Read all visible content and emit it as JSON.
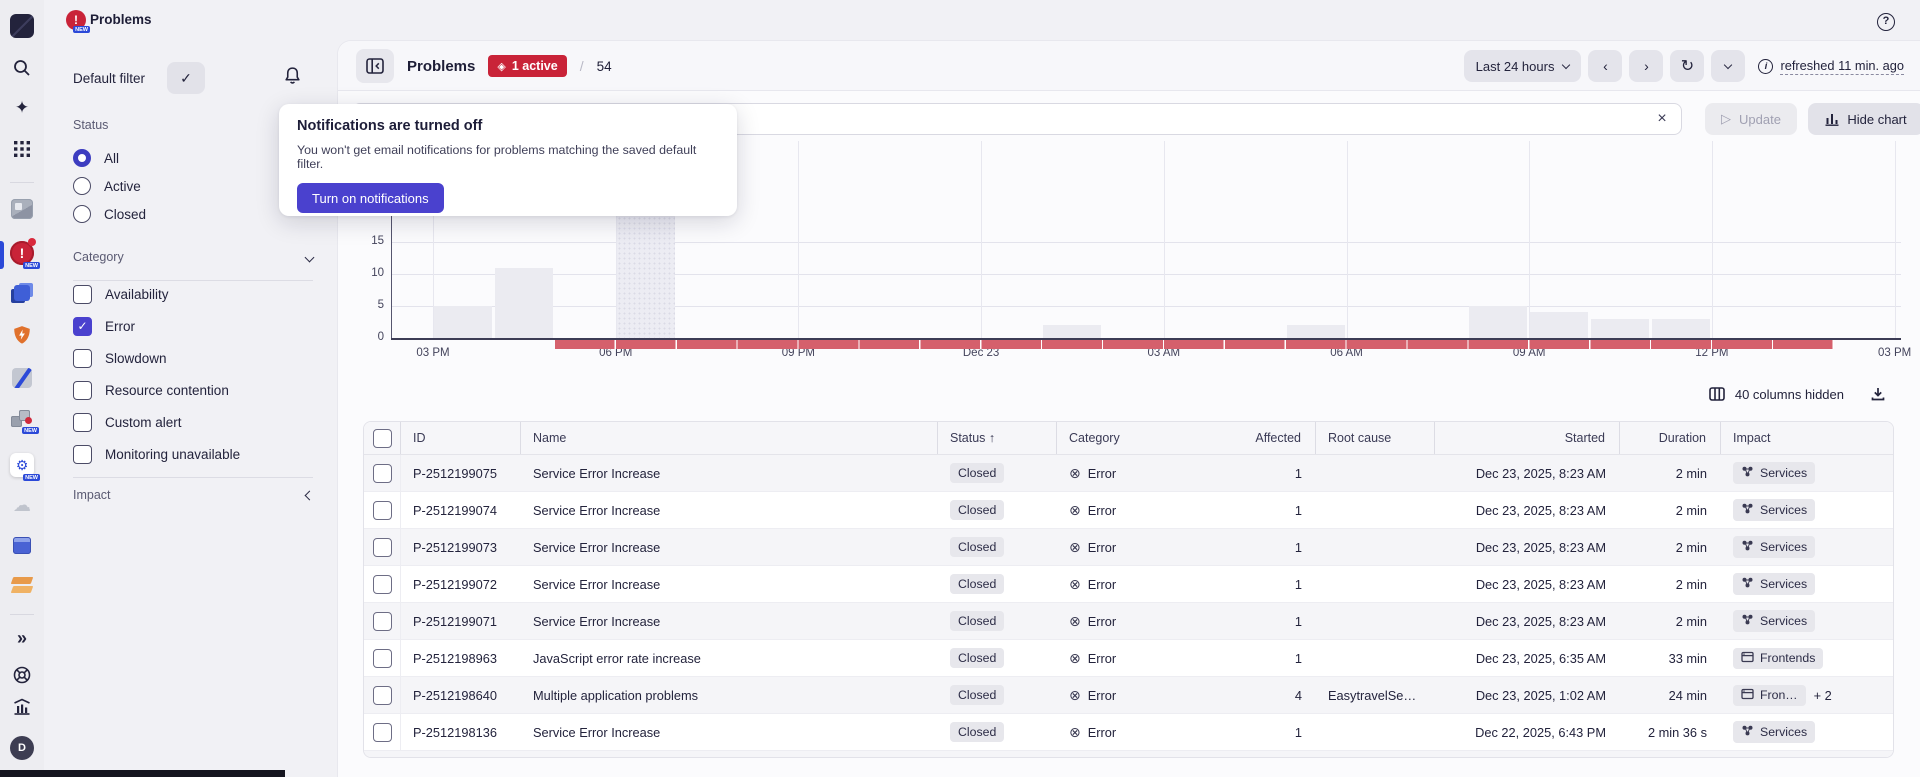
{
  "colors": {
    "accent": "#4a41ce",
    "badge_red": "#c92338",
    "problem_strip_red": "#d5606c",
    "active_indicator_blue": "#2b49d8"
  },
  "icons": {
    "check": "✓",
    "clear": "×",
    "prev": "‹",
    "next": "›",
    "refresh": "↻",
    "play": "▷",
    "circle_x": "⊗",
    "sort_up": "↑",
    "expand": "»",
    "cloud": "☁",
    "gear": "⚙",
    "sparkle": "✦",
    "diamond": "◈",
    "question": "?",
    "exclamation": "!",
    "info": "i",
    "slash": "/"
  },
  "topbar": {
    "app_title": "Problems"
  },
  "rail": {
    "avatar_letter": "D",
    "new_badge": "NEW"
  },
  "sidebar": {
    "default_filter_label": "Default filter",
    "status": {
      "label": "Status",
      "options": [
        {
          "label": "All",
          "selected": true
        },
        {
          "label": "Active",
          "selected": false
        },
        {
          "label": "Closed",
          "selected": false
        }
      ]
    },
    "category": {
      "label": "Category",
      "options": [
        {
          "label": "Availability",
          "checked": false
        },
        {
          "label": "Error",
          "checked": true
        },
        {
          "label": "Slowdown",
          "checked": false
        },
        {
          "label": "Resource contention",
          "checked": false
        },
        {
          "label": "Custom alert",
          "checked": false
        },
        {
          "label": "Monitoring unavailable",
          "checked": false
        }
      ]
    },
    "impact": {
      "label": "Impact"
    }
  },
  "popover": {
    "title": "Notifications are turned off",
    "body": "You won't get email notifications for problems matching the saved default filter.",
    "button": "Turn on notifications"
  },
  "header": {
    "title": "Problems",
    "active_badge": "1 active",
    "separator": "/",
    "total": "54",
    "time_range": "Last 24 hours",
    "refreshed": "refreshed 11 min. ago"
  },
  "filterbar": {
    "input_value": "",
    "update_label": "Update",
    "hide_chart_label": "Hide chart"
  },
  "chart_data": {
    "type": "bar",
    "title": "",
    "ylabel": "",
    "grid": true,
    "y_ticks": [
      0,
      5,
      10,
      15
    ],
    "x_tick_labels": [
      "03 PM",
      "06 PM",
      "09 PM",
      "Dec 23",
      "03 AM",
      "06 AM",
      "09 AM",
      "12 PM",
      "03 PM"
    ],
    "x_axis_start": "Dec 22, 2 PM",
    "bars": [
      {
        "time": "Dec 22, 3 PM",
        "hour_offset": 1,
        "value": 5
      },
      {
        "time": "Dec 22, 4 PM",
        "hour_offset": 2,
        "value": 11
      },
      {
        "time": "Dec 22, 6 PM",
        "hour_offset": 4,
        "value": 30,
        "highlight": true
      },
      {
        "time": "Dec 23, 1 AM",
        "hour_offset": 11,
        "value": 2
      },
      {
        "time": "Dec 23, 5 AM",
        "hour_offset": 15,
        "value": 2
      },
      {
        "time": "Dec 23, 8 AM",
        "hour_offset": 18,
        "value": 5
      },
      {
        "time": "Dec 23, 9 AM",
        "hour_offset": 19,
        "value": 4
      },
      {
        "time": "Dec 23, 10 AM",
        "hour_offset": 20,
        "value": 3
      },
      {
        "time": "Dec 23, 11 AM",
        "hour_offset": 21,
        "value": 3
      }
    ],
    "problem_timeline_strip": {
      "color": "#d5606c",
      "from_hour_offset": 3,
      "to_hour_offset": 24,
      "description": "red segmented strip along baseline marking problem activity from Dec 22 5 PM to Dec 23 2 PM"
    }
  },
  "table": {
    "columns_hidden": "40 columns hidden",
    "headers": [
      {
        "label": "ID"
      },
      {
        "label": "Name"
      },
      {
        "label": "Status",
        "sorted": "asc"
      },
      {
        "label": "Category"
      },
      {
        "label": "Affected",
        "align": "right"
      },
      {
        "label": "Root cause"
      },
      {
        "label": "Started",
        "align": "right"
      },
      {
        "label": "Duration",
        "align": "right"
      },
      {
        "label": "Impact"
      }
    ],
    "rows": [
      {
        "id": "P-2512199075",
        "name": "Service Error Increase",
        "status": "Closed",
        "category": "Error",
        "affected": "1",
        "root_cause": "",
        "started": "Dec 23, 2025, 8:23 AM",
        "duration": "2 min",
        "impact": {
          "icon": "services",
          "label": "Services",
          "extra": ""
        }
      },
      {
        "id": "P-2512199074",
        "name": "Service Error Increase",
        "status": "Closed",
        "category": "Error",
        "affected": "1",
        "root_cause": "",
        "started": "Dec 23, 2025, 8:23 AM",
        "duration": "2 min",
        "impact": {
          "icon": "services",
          "label": "Services",
          "extra": ""
        }
      },
      {
        "id": "P-2512199073",
        "name": "Service Error Increase",
        "status": "Closed",
        "category": "Error",
        "affected": "1",
        "root_cause": "",
        "started": "Dec 23, 2025, 8:23 AM",
        "duration": "2 min",
        "impact": {
          "icon": "services",
          "label": "Services",
          "extra": ""
        }
      },
      {
        "id": "P-2512199072",
        "name": "Service Error Increase",
        "status": "Closed",
        "category": "Error",
        "affected": "1",
        "root_cause": "",
        "started": "Dec 23, 2025, 8:23 AM",
        "duration": "2 min",
        "impact": {
          "icon": "services",
          "label": "Services",
          "extra": ""
        }
      },
      {
        "id": "P-2512199071",
        "name": "Service Error Increase",
        "status": "Closed",
        "category": "Error",
        "affected": "1",
        "root_cause": "",
        "started": "Dec 23, 2025, 8:23 AM",
        "duration": "2 min",
        "impact": {
          "icon": "services",
          "label": "Services",
          "extra": ""
        }
      },
      {
        "id": "P-2512198963",
        "name": "JavaScript error rate increase",
        "status": "Closed",
        "category": "Error",
        "affected": "1",
        "root_cause": "",
        "started": "Dec 23, 2025, 6:35 AM",
        "duration": "33 min",
        "impact": {
          "icon": "frontends",
          "label": "Frontends",
          "extra": ""
        }
      },
      {
        "id": "P-2512198640",
        "name": "Multiple application problems",
        "status": "Closed",
        "category": "Error",
        "affected": "4",
        "root_cause": "EasytravelSe…",
        "started": "Dec 23, 2025, 1:02 AM",
        "duration": "24 min",
        "impact": {
          "icon": "frontends",
          "label": "Fron…",
          "extra": "+ 2"
        }
      },
      {
        "id": "P-2512198136",
        "name": "Service Error Increase",
        "status": "Closed",
        "category": "Error",
        "affected": "1",
        "root_cause": "",
        "started": "Dec 22, 2025, 6:43 PM",
        "duration": "2 min 36 s",
        "impact": {
          "icon": "services",
          "label": "Services",
          "extra": ""
        }
      }
    ]
  }
}
